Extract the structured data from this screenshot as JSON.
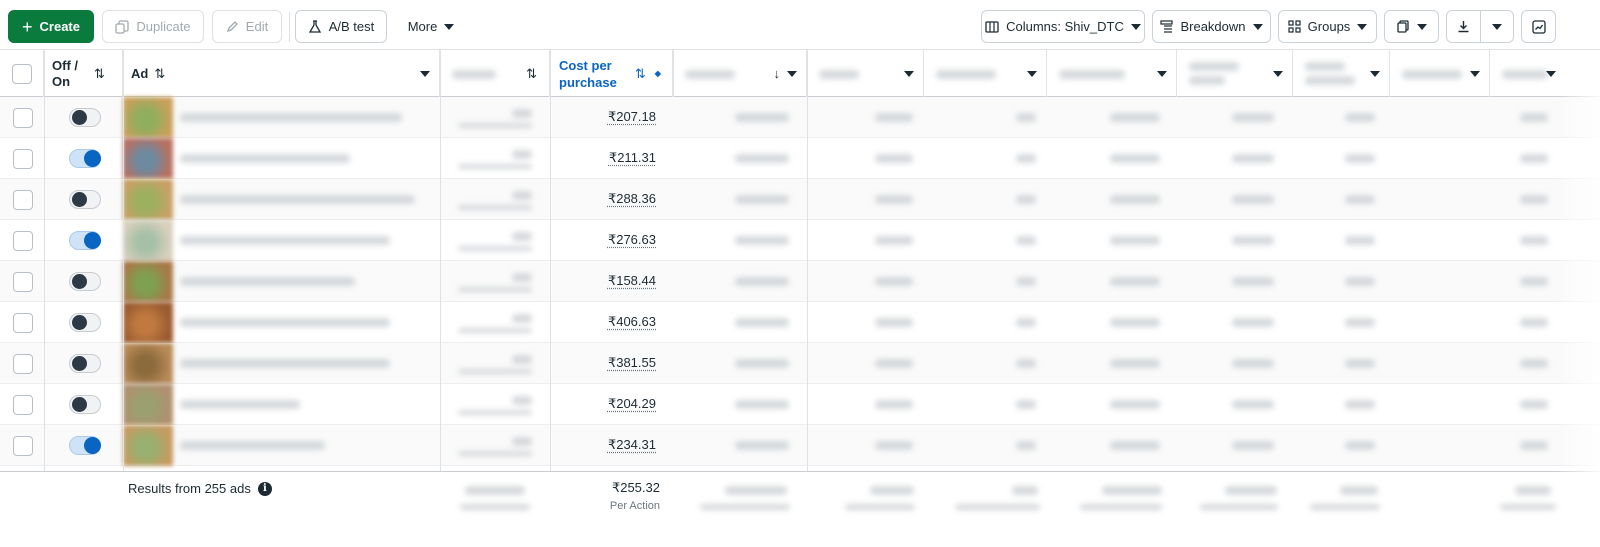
{
  "toolbar": {
    "create": "Create",
    "duplicate": "Duplicate",
    "edit": "Edit",
    "ab_test": "A/B test",
    "more": "More",
    "columns": "Columns: Shiv_DTC",
    "breakdown": "Breakdown",
    "groups": "Groups"
  },
  "header": {
    "off_on": "Off /\nOn",
    "off": "Off /",
    "on": "On",
    "ad": "Ad",
    "cost_per_purchase_line1": "Cost per",
    "cost_per_purchase_line2": "purchase"
  },
  "rows": [
    {
      "on": false,
      "cost": "₹207.18"
    },
    {
      "on": true,
      "cost": "₹211.31"
    },
    {
      "on": false,
      "cost": "₹288.36"
    },
    {
      "on": true,
      "cost": "₹276.63"
    },
    {
      "on": false,
      "cost": "₹158.44"
    },
    {
      "on": false,
      "cost": "₹406.63"
    },
    {
      "on": false,
      "cost": "₹381.55"
    },
    {
      "on": false,
      "cost": "₹204.29"
    },
    {
      "on": true,
      "cost": "₹234.31"
    }
  ],
  "footer": {
    "results": "Results from 255 ads",
    "total_cost": "₹255.32",
    "per_action": "Per Action"
  },
  "colors": {
    "primary_green": "#0a7a3d",
    "link_blue": "#0a64c2",
    "toggle_on": "#0a64c2"
  }
}
